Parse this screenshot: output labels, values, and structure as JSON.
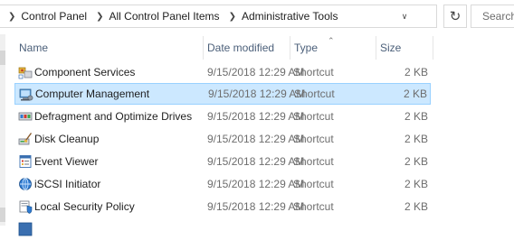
{
  "breadcrumb": {
    "items": [
      "Control Panel",
      "All Control Panel Items",
      "Administrative Tools"
    ]
  },
  "search": {
    "placeholder": "Search Administrative Tools"
  },
  "columns": {
    "name": "Name",
    "date": "Date modified",
    "type": "Type",
    "size": "Size"
  },
  "files": [
    {
      "name": "Component Services",
      "date": "9/15/2018 12:29 AM",
      "type": "Shortcut",
      "size": "2 KB",
      "icon": "component-services-icon",
      "selected": false
    },
    {
      "name": "Computer Management",
      "date": "9/15/2018 12:29 AM",
      "type": "Shortcut",
      "size": "2 KB",
      "icon": "computer-management-icon",
      "selected": true
    },
    {
      "name": "Defragment and Optimize Drives",
      "date": "9/15/2018 12:29 AM",
      "type": "Shortcut",
      "size": "2 KB",
      "icon": "defragment-icon",
      "selected": false
    },
    {
      "name": "Disk Cleanup",
      "date": "9/15/2018 12:29 AM",
      "type": "Shortcut",
      "size": "2 KB",
      "icon": "disk-cleanup-icon",
      "selected": false
    },
    {
      "name": "Event Viewer",
      "date": "9/15/2018 12:29 AM",
      "type": "Shortcut",
      "size": "2 KB",
      "icon": "event-viewer-icon",
      "selected": false
    },
    {
      "name": "iSCSI Initiator",
      "date": "9/15/2018 12:29 AM",
      "type": "Shortcut",
      "size": "2 KB",
      "icon": "iscsi-initiator-icon",
      "selected": false
    },
    {
      "name": "Local Security Policy",
      "date": "9/15/2018 12:29 AM",
      "type": "Shortcut",
      "size": "2 KB",
      "icon": "local-security-policy-icon",
      "selected": false
    }
  ],
  "colors": {
    "selection_bg": "#cce8ff",
    "selection_border": "#99d1ff",
    "header_text": "#4c607a"
  }
}
